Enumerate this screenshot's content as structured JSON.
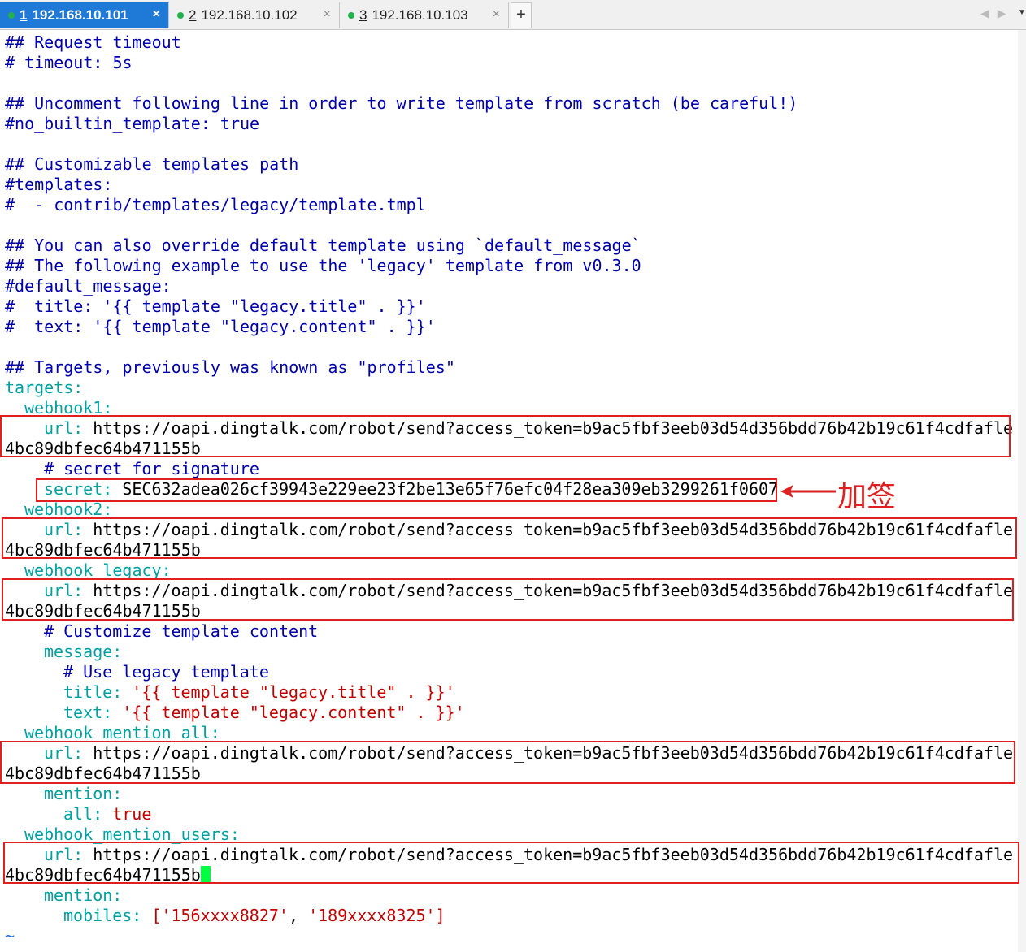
{
  "tabs": [
    {
      "num": "1",
      "host": "192.168.10.101",
      "active": true
    },
    {
      "num": "2",
      "host": "192.168.10.102",
      "active": false
    },
    {
      "num": "3",
      "host": "192.168.10.103",
      "active": false
    }
  ],
  "tab_close": "×",
  "add_tab": "+",
  "annotation": "加签",
  "editor": {
    "l1": "## Request timeout",
    "l2": "# timeout: 5s",
    "l3": "## Uncomment following line in order to write template from scratch (be careful!)",
    "l4": "#no_builtin_template: true",
    "l5": "## Customizable templates path",
    "l6": "#templates:",
    "l7": "#  - contrib/templates/legacy/template.tmpl",
    "l8": "## You can also override default template using `default_message`",
    "l9": "## The following example to use the 'legacy' template from v0.3.0",
    "l10": "#default_message:",
    "l11": "#  title: '{{ template \"legacy.title\" . }}'",
    "l12": "#  text: '{{ template \"legacy.content\" . }}'",
    "l13": "## Targets, previously was known as \"profiles\"",
    "targets_key": "targets:",
    "webhook1_key": "webhook1:",
    "url_key": "url:",
    "url_val1": " https://oapi.dingtalk.com/robot/send?access_token=b9ac5fbf3eeb03d54d356bdd76b42b19c61f4cdfafle",
    "url_val2": "4bc89dbfec64b471155b",
    "secret_comment": "# secret for signature",
    "secret_key": "secret:",
    "secret_val": " SEC632adea026cf39943e229ee23f2be13e65f76efc04f28ea309eb3299261f0607",
    "webhook2_key": "webhook2:",
    "webhook_legacy_key": "webhook_legacy:",
    "customize_comment": "# Customize template content",
    "message_key": "message:",
    "use_legacy_comment": "# Use legacy template",
    "title_key": "title:",
    "title_val": " '{{ template \"legacy.title\" . }}'",
    "text_key": "text:",
    "text_val": " '{{ template \"legacy.content\" . }}'",
    "webhook_mention_all_key": "webhook_mention_all:",
    "mention_key": "mention:",
    "all_key": "all:",
    "all_val": " true",
    "webhook_mention_users_key": "webhook_mention_users:",
    "mobiles_key": "mobiles:",
    "mobiles_open": " [",
    "mobile1": "'156xxxx8827'",
    "mobiles_sep": ", ",
    "mobile2": "'189xxxx8325'",
    "mobiles_close": "]",
    "tilde": "~"
  }
}
